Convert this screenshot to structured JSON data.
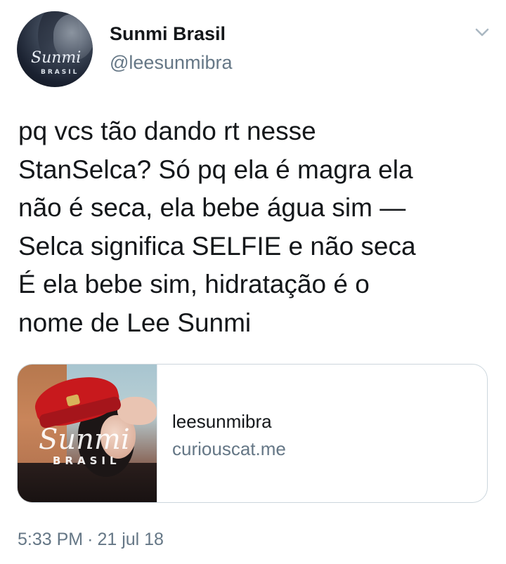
{
  "author": {
    "display_name": "Sunmi Brasil",
    "handle": "@leesunmibra",
    "avatar_logo": "Sunmi",
    "avatar_logo_sub": "BRASIL"
  },
  "header": {
    "menu_icon": "chevron-down-icon"
  },
  "tweet": {
    "text_lines": [
      "pq vcs tão dando rt nesse",
      "StanSelca? Só pq ela é magra ela",
      "não é seca, ela bebe água sim —",
      "Selca significa SELFIE e não seca",
      "É ela bebe sim, hidratação é o",
      "nome de Lee Sunmi"
    ]
  },
  "link_card": {
    "title": "leesunmibra",
    "domain": "curiouscat.me",
    "image_logo": "Sunmi",
    "image_logo_sub": "BRASIL"
  },
  "meta": {
    "time": "5:33 PM",
    "separator": "·",
    "date": "21 jul 18"
  },
  "colors": {
    "text_primary": "#14171a",
    "text_secondary": "#657786",
    "border": "#ccd6dd",
    "hat_red": "#c8191d"
  }
}
